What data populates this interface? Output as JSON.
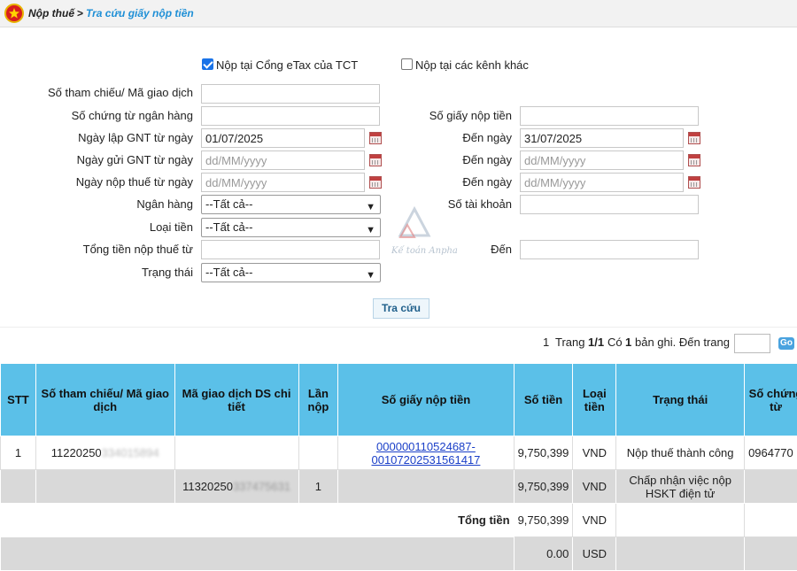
{
  "breadcrumb": {
    "home": "Nộp thuế",
    "separator": ">",
    "current": "Tra cứu giấy nộp tiền"
  },
  "channels": {
    "etax_label": "Nộp tại Cổng eTax của TCT",
    "etax_checked": true,
    "other_label": "Nộp tại các kênh khác",
    "other_checked": false
  },
  "form": {
    "ref_label": "Số tham chiếu/ Mã giao dịch",
    "bank_doc_label": "Số chứng từ ngân hàng",
    "payment_no_label": "Số giấy nộp tiền",
    "created_from_label": "Ngày lập GNT từ ngày",
    "created_from": "01/07/2025",
    "to_label": "Đến ngày",
    "created_to": "31/07/2025",
    "sent_from_label": "Ngày gửi GNT từ ngày",
    "paid_from_label": "Ngày nộp thuế từ ngày",
    "date_placeholder": "dd/MM/yyyy",
    "bank_label": "Ngân hàng",
    "account_label": "Số tài khoản",
    "currency_label": "Loại tiền",
    "amount_from_label": "Tổng tiền nộp thuế từ",
    "amount_to_label": "Đến",
    "status_label": "Trạng thái",
    "all_option": "--Tất cả--",
    "search_button": "Tra cứu"
  },
  "pager": {
    "page": "1",
    "page_text": "Trang",
    "page_of": "1/1",
    "count_text": "Có",
    "count": "1",
    "records_text": "bản ghi. Đến trang",
    "go": "Go"
  },
  "table": {
    "headers": [
      "STT",
      "Số tham chiếu/ Mã giao dịch",
      "Mã giao dịch DS chi tiết",
      "Lần nộp",
      "Số giấy nộp tiền",
      "Số tiền",
      "Loại tiền",
      "Trạng thái",
      "Số chứng từ"
    ],
    "row1": {
      "stt": "1",
      "ref": "11220250",
      "ref_hidden": "334015894",
      "payment_no_a": "000000110524687-",
      "payment_no_b": "00107202531561417",
      "amount": "9,750,399",
      "currency": "VND",
      "status": "Nộp thuế thành công",
      "doc_no": "0964770"
    },
    "row2": {
      "detail": "11320250",
      "detail_hidden": "337475631",
      "times": "1",
      "amount": "9,750,399",
      "currency": "VND",
      "status": "Chấp nhận việc nộp HSKT điện tử"
    },
    "total_label": "Tổng tiền",
    "total_vnd": "9,750,399",
    "total_vnd_cur": "VND",
    "total_usd": "0.00",
    "total_usd_cur": "USD"
  },
  "watermark": "Kế toán Anpha",
  "colors": {
    "header_bg": "#5bc0e8",
    "link": "#1a3fc8",
    "crumb_current": "#1e8fd6"
  }
}
